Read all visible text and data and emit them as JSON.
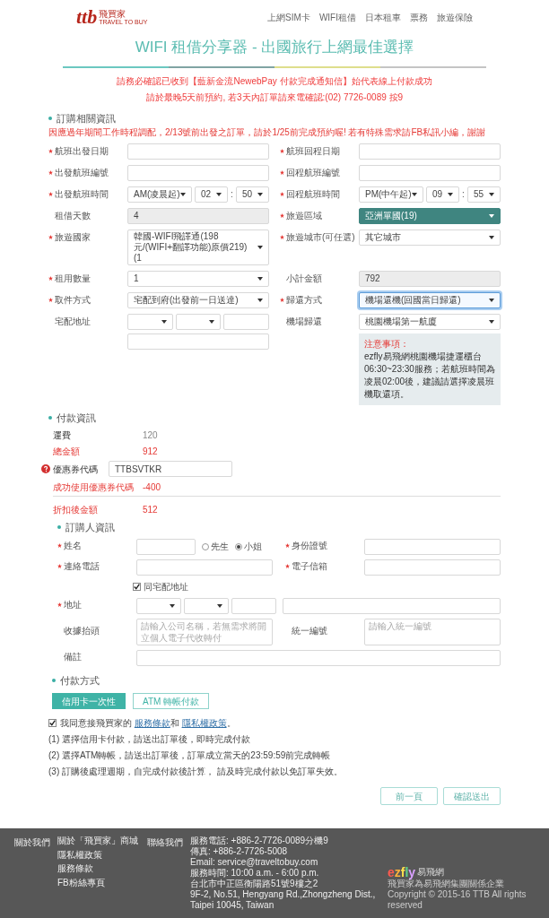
{
  "header": {
    "logo": {
      "mark": "ttb",
      "brand": "飛買家",
      "tagline": "TRAVEL TO BUY"
    },
    "nav": [
      "上網SIM卡",
      "WIFI租借",
      "日本租車",
      "票務",
      "旅遊保險"
    ]
  },
  "title": "WIFI 租借分享器 - 出國旅行上網最佳選擇",
  "notices": [
    "請務必確認已收到【藍新金流NewebPay 付款完成通知信】始代表線上付款成功",
    "請於最晚5天前預約, 若3天內訂單請來電確認:(02) 7726-0089 按9"
  ],
  "order_section": {
    "title": "訂購相關資訊",
    "notice": "因應過年期間工作時程調配，2/13號前出發之訂單，請於1/25前完成預約喔! 若有特殊需求請FB私訊小編，謝謝",
    "fields": [
      {
        "kind": "text",
        "label": "航班出發日期",
        "required": true
      },
      {
        "kind": "text",
        "label": "航班回程日期",
        "required": true
      },
      {
        "kind": "text",
        "label": "出發航班編號",
        "required": true
      },
      {
        "kind": "text",
        "label": "回程航班編號",
        "required": true
      },
      {
        "kind": "time",
        "label": "出發航班時間",
        "required": true,
        "period": "AM(凌晨起)",
        "hour": "02",
        "separator": ":",
        "minute": "50"
      },
      {
        "kind": "time",
        "label": "回程航班時間",
        "required": true,
        "period": "PM(中午起)",
        "hour": "09",
        "separator": ":",
        "minute": "55"
      },
      {
        "kind": "readonly",
        "label": "租借天數",
        "required": false,
        "value": "4"
      },
      {
        "kind": "select",
        "label": "旅遊區域",
        "required": true,
        "value": "亞洲單國(19)",
        "highlighted": true,
        "focused": false
      },
      {
        "kind": "select",
        "label": "旅遊國家",
        "required": true,
        "value": "韓國-WIFI飛譯通(198元/(WIFI+翻譯功能)原價219)(1",
        "highlighted": false,
        "focused": false
      },
      {
        "kind": "select",
        "label": "旅遊城市(可任選)",
        "required": true,
        "value": "其它城市",
        "highlighted": false,
        "focused": false
      },
      {
        "kind": "select",
        "label": "租用數量",
        "required": true,
        "value": "1",
        "highlighted": false,
        "focused": false
      },
      {
        "kind": "readonly",
        "label": "小計金額",
        "required": false,
        "value": "792"
      },
      {
        "kind": "select",
        "label": "取件方式",
        "required": true,
        "value": "宅配到府(出發前一日送達)",
        "highlighted": false,
        "focused": false
      },
      {
        "kind": "select",
        "label": "歸還方式",
        "required": true,
        "value": "機場還機(回國當日歸還)",
        "highlighted": false,
        "focused": true
      },
      {
        "kind": "address",
        "label": "宅配地址",
        "required": false
      },
      {
        "kind": "select_note",
        "label": "機場歸還",
        "required": false,
        "value": "桃園機場第一航廈",
        "note": {
          "title": "注意事項：",
          "text": "ezfly易飛網桃園機場捷運櫃台06:30~23:30服務；若航班時間為凌晨02:00後，建議請選擇凌晨班機取還項。"
        }
      }
    ]
  },
  "payment_info": {
    "title": "付款資訊",
    "rows": [
      {
        "kind": "plain",
        "label": "運費",
        "value": "120"
      },
      {
        "kind": "alert",
        "label": "總金額",
        "value": "912"
      },
      {
        "kind": "coupon",
        "label": "優惠券代碼",
        "value": "TTBSVTKR"
      },
      {
        "kind": "alert",
        "label": "成功使用優惠券代碼",
        "value": "-400"
      },
      {
        "kind": "total",
        "label": "折扣後金額",
        "value": "512"
      }
    ]
  },
  "buyer_section": {
    "title": "訂購人資訊",
    "fields": [
      {
        "kind": "name",
        "label": "姓名",
        "required": true,
        "options": [
          {
            "label": "先生",
            "selected": false
          },
          {
            "label": "小姐",
            "selected": true
          }
        ]
      },
      {
        "kind": "text",
        "label": "身份證號",
        "required": true
      },
      {
        "kind": "text",
        "label": "連絡電話",
        "required": true
      },
      {
        "kind": "text",
        "label": "電子信箱",
        "required": true
      },
      {
        "kind": "checkbox",
        "label": "同宅配地址",
        "checked": true
      },
      {
        "kind": "address_inline",
        "label": "地址",
        "required": true
      },
      {
        "kind": "text",
        "label": "收據抬頭",
        "required": false,
        "placeholder": "請輸入公司名稱，若無需求將開立個人電子代收轉付"
      },
      {
        "kind": "text",
        "label": "統一編號",
        "required": false,
        "placeholder": "請輸入統一編號"
      },
      {
        "kind": "wide",
        "label": "備註",
        "required": false
      }
    ]
  },
  "payment_method": {
    "title": "付款方式",
    "options": [
      {
        "label": "信用卡一次性",
        "selected": true
      },
      {
        "label": "ATM 轉帳付款",
        "selected": false
      }
    ]
  },
  "agreement": {
    "checked": true,
    "parts": [
      {
        "kind": "text",
        "text": "我同意接飛買家的 "
      },
      {
        "kind": "link",
        "text": "服務條款"
      },
      {
        "kind": "text",
        "text": "和 "
      },
      {
        "kind": "link",
        "text": "隱私權政策"
      },
      {
        "kind": "text",
        "text": "。"
      }
    ]
  },
  "payment_notes": [
    "(1) 選擇信用卡付款，請送出訂單後，即時完成付款",
    "(2) 選擇ATM轉帳，請送出訂單後，訂單成立當天的23:59:59前完成轉帳",
    "(3) 訂購後處理週期，自完成付款後計算， 請及時完成付款以免訂單失效。"
  ],
  "actions": [
    "前一頁",
    "確認送出"
  ],
  "footer": {
    "about": {
      "title": "關於我們",
      "links": [
        "關於「飛買家」商城",
        "隱私權政策",
        "服務條款",
        "FB粉絲專頁"
      ]
    },
    "contact": {
      "title": "聯絡我們",
      "lines": [
        "服務電話: +886-2-7726-0089分機9",
        "傳真: +886-2-7726-5008",
        "Email: service@traveltobuy.com",
        "服務時間: 10:00 a.m. - 6:00 p.m.",
        "台北市中正區衡陽路51號9樓之2",
        "9F-2, No.51, Hengyang Rd.,Zhongzheng Dist.,",
        "Taipei 10045, Taiwan"
      ]
    },
    "partner": {
      "logo": "ezfly",
      "logo_sub": "易飛網",
      "lines": [
        "飛買家為易飛網集團關係企業",
        "Copyright © 2015-16 TTB All rights reserved"
      ]
    }
  }
}
